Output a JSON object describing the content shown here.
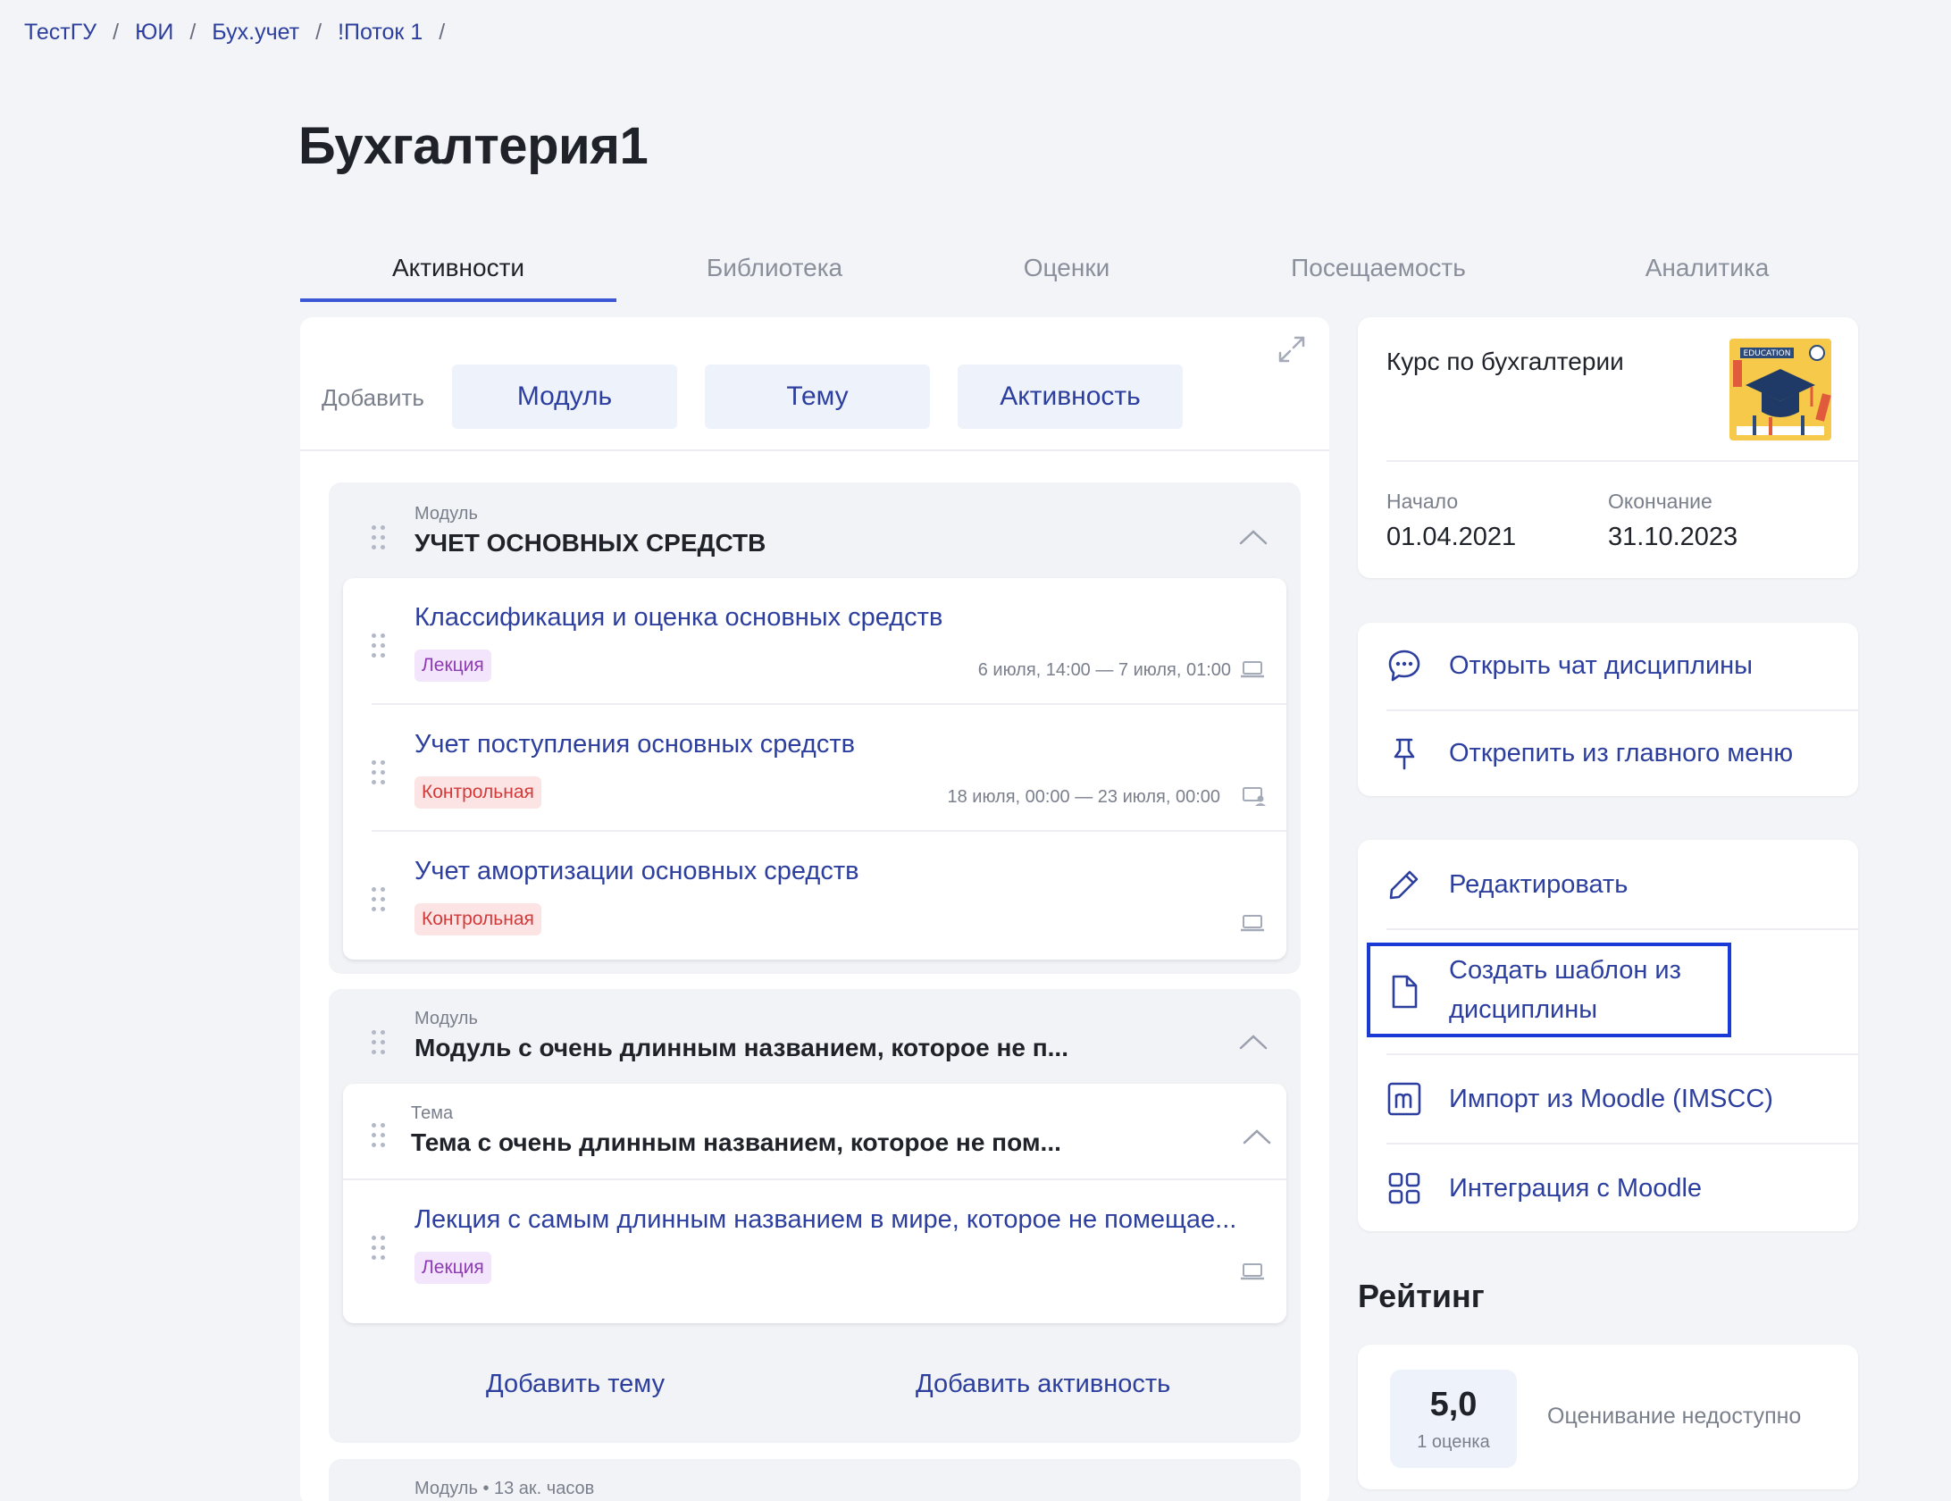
{
  "breadcrumb": [
    "ТестГУ",
    "ЮИ",
    "Бух.учет",
    "!Поток 1"
  ],
  "breadcrumb_separator": "/",
  "page_title": "Бухгалтерия1",
  "tabs": [
    {
      "label": "Активности",
      "active": true
    },
    {
      "label": "Библиотека",
      "active": false
    },
    {
      "label": "Оценки",
      "active": false
    },
    {
      "label": "Посещаемость",
      "active": false
    },
    {
      "label": "Аналитика",
      "active": false
    }
  ],
  "add_bar": {
    "label": "Добавить",
    "buttons": [
      "Модуль",
      "Тему",
      "Активность"
    ],
    "expand_icon": "expand-icon"
  },
  "modules": [
    {
      "label": "Модуль",
      "title": "УЧЕТ ОСНОВНЫХ СРЕДСТВ",
      "activities": [
        {
          "title": "Классификация и оценка основных средств",
          "type": "Лекция",
          "type_kind": "lecture",
          "dates": "6 июля, 14:00 — 7 июля, 01:00",
          "icon": "laptop-icon"
        },
        {
          "title": "Учет поступления основных средств",
          "type": "Контрольная",
          "type_kind": "test",
          "dates": "18 июля, 00:00 — 23 июля, 00:00",
          "icon": "classroom-icon"
        },
        {
          "title": "Учет амортизации основных средств",
          "type": "Контрольная",
          "type_kind": "test",
          "dates": "",
          "icon": "laptop-icon"
        }
      ]
    },
    {
      "label": "Модуль",
      "title": "Модуль с очень длинным названием, которое не п...",
      "topic": {
        "label": "Тема",
        "title": "Тема с очень длинным названием, которое не пом..."
      },
      "activities": [
        {
          "title": "Лекция с самым длинным названием в мире, которое не помещае...",
          "type": "Лекция",
          "type_kind": "lecture",
          "dates": "",
          "icon": "laptop-icon"
        }
      ],
      "actions": [
        "Добавить тему",
        "Добавить активность"
      ]
    },
    {
      "label": "Модуль • 13 ак. часов"
    }
  ],
  "course": {
    "name": "Курс по бухгалтерии",
    "image_text": "EDUCATION",
    "start_label": "Начало",
    "start_date": "01.04.2021",
    "end_label": "Окончание",
    "end_date": "31.10.2023"
  },
  "menu_primary": [
    {
      "label": "Открыть чат дисциплины",
      "icon": "chat-icon"
    },
    {
      "label": "Открепить из главного меню",
      "icon": "pin-icon"
    }
  ],
  "menu_secondary": [
    {
      "label": "Редактировать",
      "icon": "pencil-icon"
    },
    {
      "label_line1": "Создать шаблон из",
      "label_line2": "дисциплины",
      "icon": "document-icon"
    },
    {
      "label": "Импорт из Moodle (IMSCC)",
      "icon": "moodle-icon"
    },
    {
      "label": "Интеграция с Moodle",
      "icon": "grid-icon"
    }
  ],
  "rating": {
    "title": "Рейтинг",
    "value": "5,0",
    "count": "1 оценка",
    "status": "Оценивание недоступно"
  },
  "colors": {
    "accent": "#3b57d6",
    "link": "#2d3f9e",
    "highlight": "#1a3ad6",
    "lecture_badge": "#8e3bb5",
    "test_badge": "#d23a3a"
  }
}
